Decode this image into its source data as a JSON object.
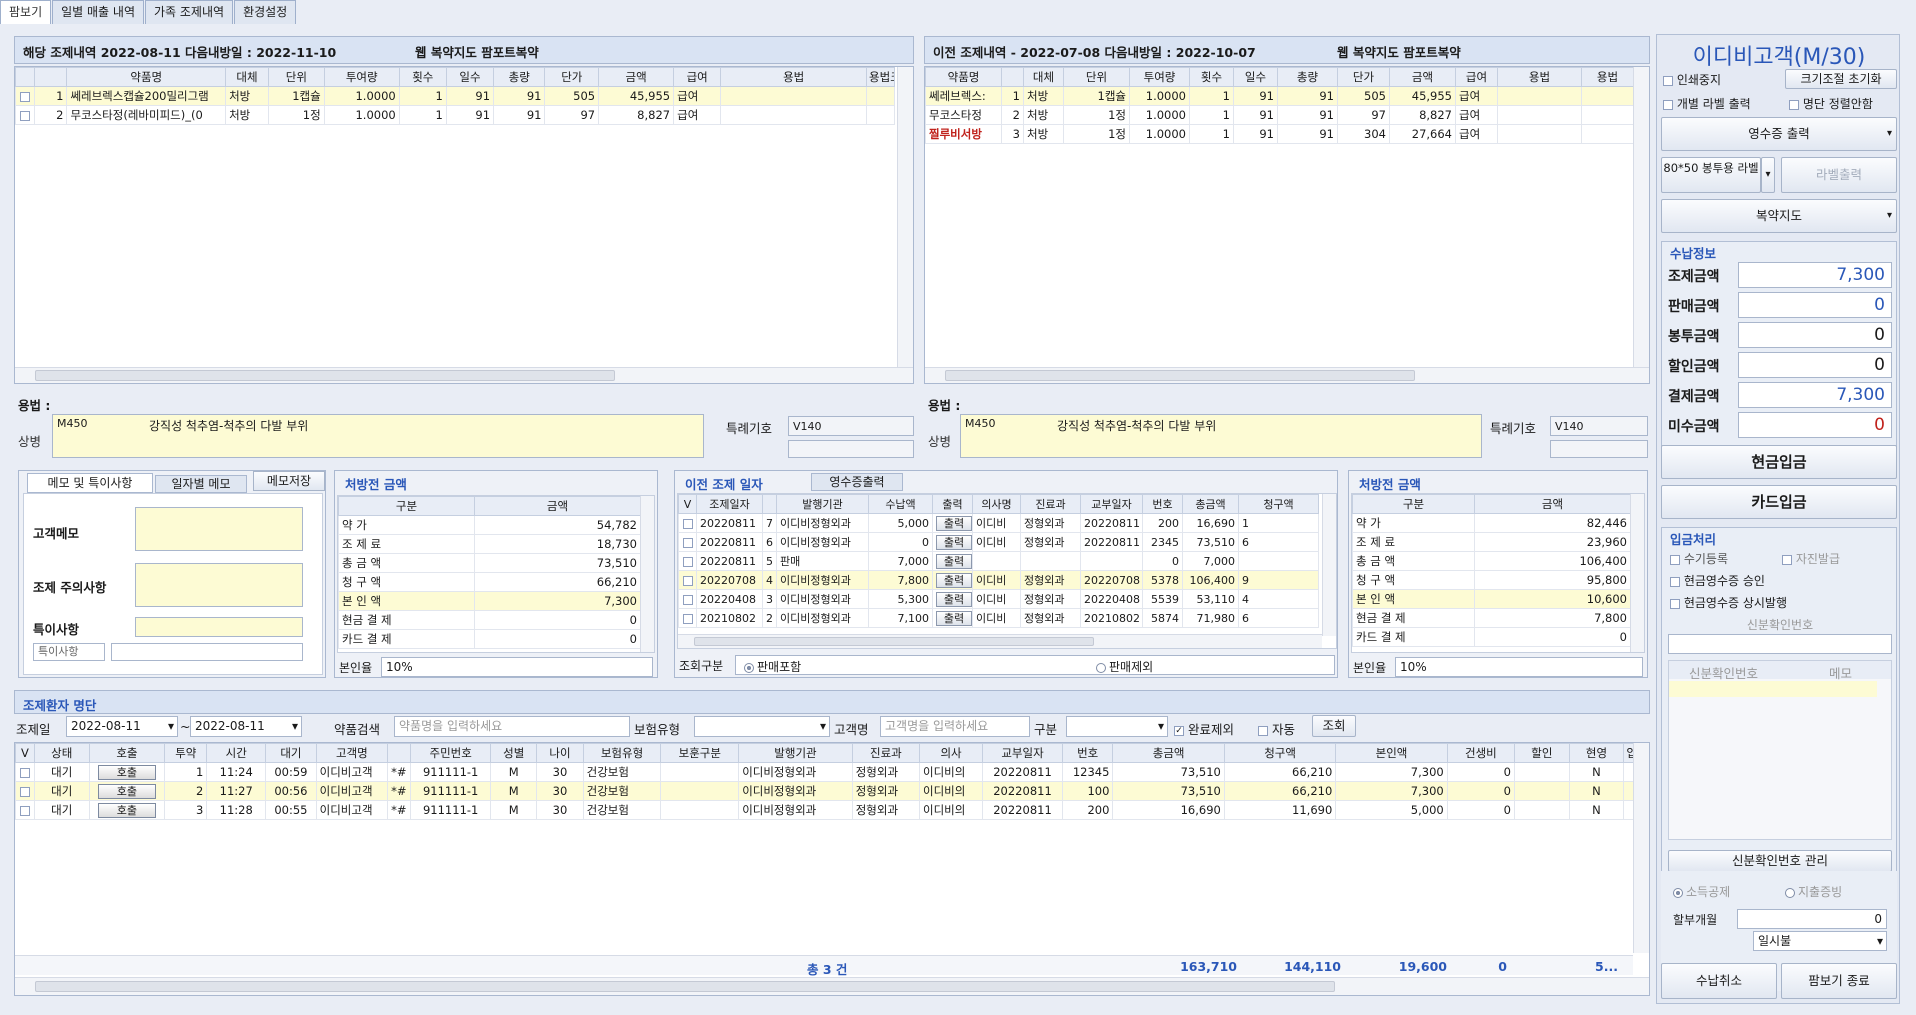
{
  "tabs": [
    "팜보기",
    "일별 매출 내역",
    "가족 조제내역",
    "환경설정"
  ],
  "current": {
    "title": "해당 조제내역 2022-08-11 다음내방일 : 2022-11-10",
    "web_label": "웹 복약지도 팜포트복약",
    "headers": [
      "약품명",
      "대체",
      "단위",
      "투여량",
      "횟수",
      "일수",
      "총량",
      "단가",
      "금액",
      "급여",
      "용법",
      "용법크"
    ],
    "rows": [
      {
        "no": "1",
        "name": "쎄레브렉스캡슐200밀리그램",
        "sub": "처방",
        "unit": "1캡슐",
        "dose": "1.0000",
        "times": "1",
        "days": "91",
        "total": "91",
        "price": "505",
        "amount": "45,955",
        "pay": "급여"
      },
      {
        "no": "2",
        "name": "무코스타정(레바미피드)_(0",
        "sub": "처방",
        "unit": "1정",
        "dose": "1.0000",
        "times": "1",
        "days": "91",
        "total": "91",
        "price": "97",
        "amount": "8,827",
        "pay": "급여"
      }
    ]
  },
  "previous": {
    "title": "이전 조제내역 - 2022-07-08 다음내방일 : 2022-10-07",
    "web_label": "웹 복약지도 팜포트복약",
    "headers": [
      "약품명",
      "대체",
      "단위",
      "투여량",
      "횟수",
      "일수",
      "총량",
      "단가",
      "금액",
      "급여",
      "용법",
      "용법"
    ],
    "rows": [
      {
        "no": "1",
        "name": "쎄레브렉스:",
        "sub": "처방",
        "unit": "1캡슐",
        "dose": "1.0000",
        "times": "1",
        "days": "91",
        "total": "91",
        "price": "505",
        "amount": "45,955",
        "pay": "급여"
      },
      {
        "no": "2",
        "name": "무코스타정",
        "sub": "처방",
        "unit": "1정",
        "dose": "1.0000",
        "times": "1",
        "days": "91",
        "total": "91",
        "price": "97",
        "amount": "8,827",
        "pay": "급여"
      },
      {
        "no": "3",
        "name": "찔루비서방",
        "sub": "처방",
        "unit": "1정",
        "dose": "1.0000",
        "times": "1",
        "days": "91",
        "total": "91",
        "price": "304",
        "amount": "27,664",
        "pay": "급여"
      }
    ]
  },
  "usage": {
    "label": "용법 :",
    "disease_label": "상병",
    "code": "M450",
    "desc": "강직성 척추염-척추의 다발 부위",
    "special_label": "특례기호",
    "special_value": "V140"
  },
  "memo": {
    "tabs": [
      "메모 및 특이사항",
      "일자별 메모"
    ],
    "save_label": "메모저장",
    "customer_memo": "고객메모",
    "caution": "조제 주의사항",
    "special": "특이사항",
    "special_btn": "특이사항"
  },
  "pre_amount_left": {
    "title": "처방전 금액",
    "headers": [
      "구분",
      "금액"
    ],
    "rows": [
      [
        "약 가",
        "54,782"
      ],
      [
        "조 제 료",
        "18,730"
      ],
      [
        "총 금 액",
        "73,510"
      ],
      [
        "청 구 액",
        "66,210"
      ],
      [
        "본 인 액",
        "7,300"
      ],
      [
        "현금 결 제",
        "0"
      ],
      [
        "카드 결 제",
        "0"
      ]
    ],
    "rate_label": "본인율",
    "rate": "10%"
  },
  "history": {
    "tabs": [
      "이전 조제 일자",
      "영수증출력"
    ],
    "headers": [
      "V",
      "조제일자",
      "",
      "발행기관",
      "수납액",
      "출력",
      "의사명",
      "진료과",
      "교부일자",
      "번호",
      "총금액",
      "청구액"
    ],
    "out_label": "출력",
    "rows": [
      [
        "20220811",
        "7",
        "이디비정형외과",
        "5,000",
        "이디비",
        "정형외과",
        "20220811",
        "200",
        "16,690",
        "1"
      ],
      [
        "20220811",
        "6",
        "이디비정형외과",
        "0",
        "이디비",
        "정형외과",
        "20220811",
        "2345",
        "73,510",
        "6"
      ],
      [
        "20220811",
        "5",
        "판매",
        "7,000",
        "",
        "",
        "",
        "0",
        "7,000",
        ""
      ],
      [
        "20220708",
        "4",
        "이디비정형외과",
        "7,800",
        "이디비",
        "정형외과",
        "20220708",
        "5378",
        "106,400",
        "9"
      ],
      [
        "20220408",
        "3",
        "이디비정형외과",
        "5,300",
        "이디비",
        "정형외과",
        "20220408",
        "5539",
        "53,110",
        "4"
      ],
      [
        "20210802",
        "2",
        "이디비정형외과",
        "7,100",
        "이디비",
        "정형외과",
        "20210802",
        "5874",
        "71,980",
        "6"
      ]
    ],
    "filter_label": "조회구분",
    "filter_a": "판매포함",
    "filter_b": "판매제외"
  },
  "pre_amount_right": {
    "title": "처방전 금액",
    "headers": [
      "구분",
      "금액"
    ],
    "rows": [
      [
        "약 가",
        "82,446"
      ],
      [
        "조 제 료",
        "23,960"
      ],
      [
        "총 금 액",
        "106,400"
      ],
      [
        "청 구 액",
        "95,800"
      ],
      [
        "본 인 액",
        "10,600"
      ],
      [
        "현금 결 제",
        "7,800"
      ],
      [
        "카드 결 제",
        "0"
      ]
    ],
    "rate_label": "본인율",
    "rate": "10%"
  },
  "patients": {
    "title": "조제환자 명단",
    "date_label": "조제일",
    "date_from": "2022-08-11",
    "date_to": "2022-08-11",
    "drug_search": "약품검색",
    "drug_ph": "약품명을 입력하세요",
    "insurance_label": "보험유형",
    "customer_label": "고객명",
    "customer_ph": "고객명을 입력하세요",
    "type_label": "구분",
    "exclude_label": "완료제외",
    "auto_label": "자동",
    "search_btn": "조회",
    "headers": [
      "V",
      "상태",
      "호출",
      "투약",
      "시간",
      "대기",
      "고객명",
      "",
      "주민번호",
      "성별",
      "나이",
      "보험유형",
      "보훈구분",
      "발행기관",
      "진료과",
      "의사",
      "교부일자",
      "번호",
      "총금액",
      "청구액",
      "본인액",
      "건생비",
      "할인",
      "현영",
      "입"
    ],
    "call_label": "호출",
    "rows": [
      [
        "대기",
        "1",
        "11:24",
        "00:59",
        "이디비고객",
        "*#",
        "911111-1",
        "M",
        "30",
        "건강보험",
        "",
        "이디비정형외과",
        "정형외과",
        "이디비의",
        "20220811",
        "12345",
        "73,510",
        "66,210",
        "7,300",
        "0",
        "",
        "N"
      ],
      [
        "대기",
        "2",
        "11:27",
        "00:56",
        "이디비고객",
        "*#",
        "911111-1",
        "M",
        "30",
        "건강보험",
        "",
        "이디비정형외과",
        "정형외과",
        "이디비의",
        "20220811",
        "100",
        "73,510",
        "66,210",
        "7,300",
        "0",
        "",
        "N"
      ],
      [
        "대기",
        "3",
        "11:28",
        "00:55",
        "이디비고객",
        "*#",
        "911111-1",
        "M",
        "30",
        "건강보험",
        "",
        "이디비정형외과",
        "정형외과",
        "이디비의",
        "20220811",
        "200",
        "16,690",
        "11,690",
        "5,000",
        "0",
        "",
        "N"
      ]
    ],
    "footer": {
      "count": "총 3 건",
      "total": "163,710",
      "claim": "144,110",
      "self": "19,600",
      "hc": "0",
      "etc": "5..."
    }
  },
  "side": {
    "customer": "이디비고객(M/30)",
    "print_stop": "인쇄중지",
    "resize": "크기조절 초기화",
    "label_print": "개별 라벨 출력",
    "sort_off": "명단 정렬안함",
    "receipt": "영수증 출력",
    "bag_label": "80*50 봉투용 라벨",
    "label_out": "라벨출력",
    "guide": "복약지도",
    "pay_title": "수납정보",
    "pay": [
      [
        "조제금액",
        "7,300"
      ],
      [
        "판매금액",
        "0"
      ],
      [
        "봉투금액",
        "0"
      ],
      [
        "할인금액",
        "0"
      ],
      [
        "결제금액",
        "7,300"
      ],
      [
        "미수금액",
        "0"
      ]
    ],
    "cash_btn": "현금입금",
    "card_btn": "카드입금",
    "deposit_title": "입금처리",
    "manual": "수기등록",
    "self_issue": "자진발급",
    "cash_approve": "현금영수증 승인",
    "cash_always": "현금영수증 상시발행",
    "id_confirm": "신분확인번호",
    "id_headers": [
      "신분확인번호",
      "메모"
    ],
    "id_manage": "신분확인번호 관리",
    "income": "소득공제",
    "expense": "지출증빙",
    "install_label": "할부개월",
    "install_value": "0",
    "lump": "일시불",
    "cancel_btn": "수납취소",
    "close_btn": "팜보기 종료"
  }
}
